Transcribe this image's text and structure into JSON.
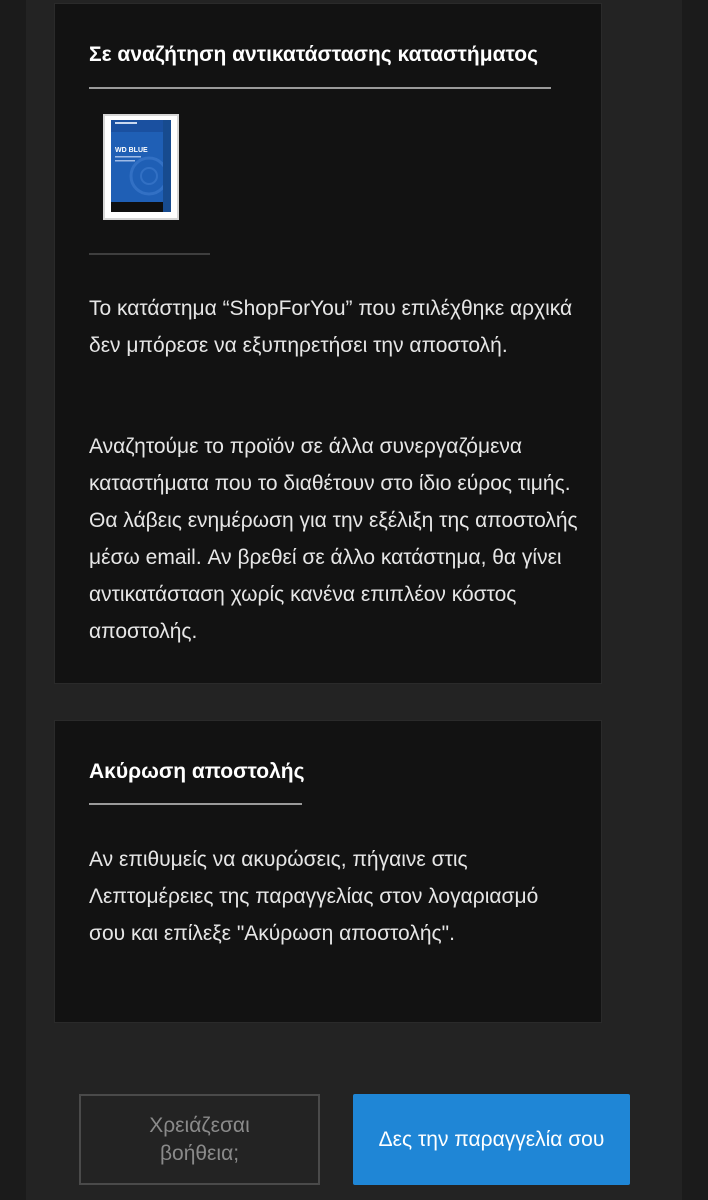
{
  "replacement_card": {
    "title": "Σε αναζήτηση αντικατάστασης καταστήματος",
    "product_image_label": "WD BLUE",
    "paragraph_1": "Το κατάστημα “ShopForYou” που επιλέχθηκε αρχικά δεν μπόρεσε να εξυπηρετήσει την αποστολή.",
    "paragraph_2": "Αναζητούμε το προϊόν σε άλλα συνεργαζόμενα καταστήματα που το διαθέτουν στο ίδιο εύρος τιμής. Θα λάβεις ενημέρωση για την εξέλιξη της αποστολής μέσω email. Αν βρεθεί σε άλλο κατάστημα, θα γίνει αντικατάσταση χωρίς κανένα επιπλέον κόστος αποστολής."
  },
  "cancel_card": {
    "title": "Ακύρωση αποστολής",
    "paragraph": "Αν επιθυμείς να ακυρώσεις, πήγαινε στις Λεπτομέρειες της παραγγελίας στον λογαριασμό σου και επίλεξε \"Ακύρωση αποστολής\"."
  },
  "actions": {
    "help_label": "Χρειάζεσαι βοήθεια;",
    "view_order_label": "Δες την παραγγελία σου"
  },
  "colors": {
    "page_background": "#1b1b1b",
    "card_background": "#121212",
    "primary_button": "#1f86d6",
    "product_blue": "#1f5fb5"
  }
}
